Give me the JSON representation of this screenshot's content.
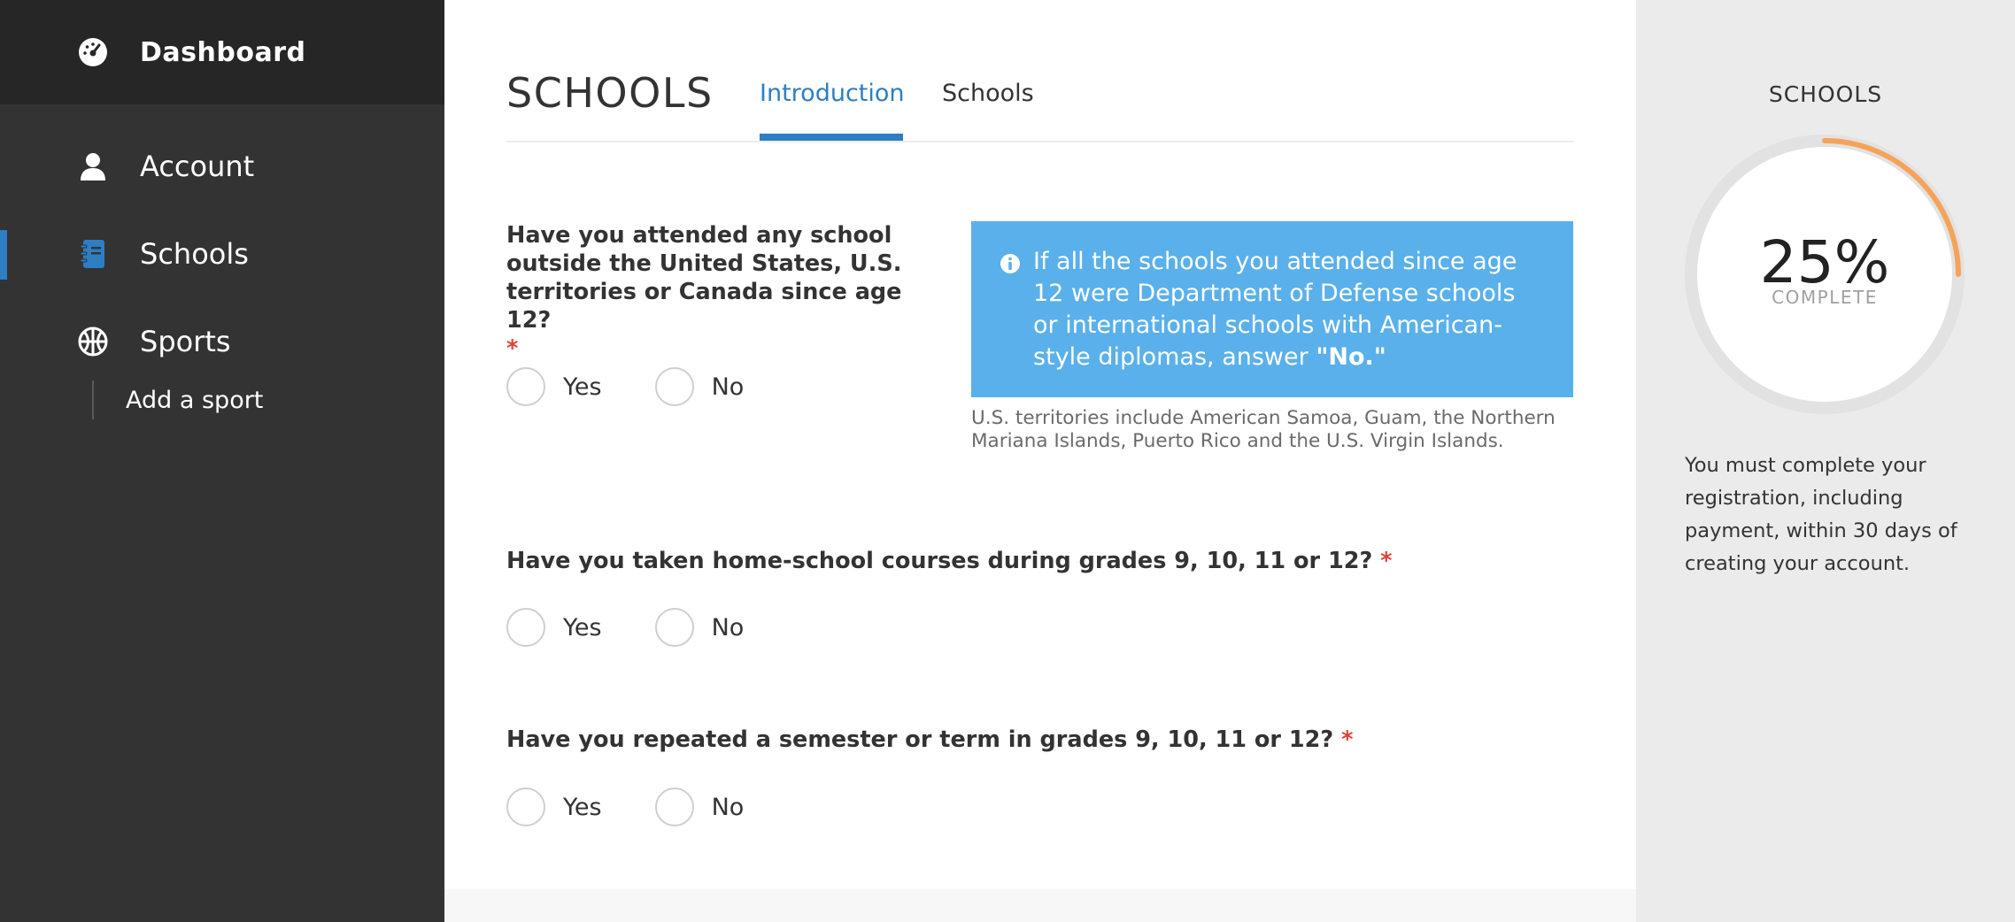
{
  "sidebar": {
    "header": {
      "label": "Dashboard",
      "icon": "dashboard-gauge-icon"
    },
    "items": [
      {
        "label": "Account",
        "icon": "user-icon"
      },
      {
        "label": "Schools",
        "icon": "notebook-icon"
      },
      {
        "label": "Sports",
        "icon": "ball-icon"
      }
    ],
    "sub_items": [
      {
        "label": "Add a sport"
      }
    ],
    "active_item": "Schools"
  },
  "main": {
    "title": "SCHOOLS",
    "tabs": [
      {
        "label": "Introduction",
        "active": true
      },
      {
        "label": "Schools",
        "active": false
      }
    ],
    "questions": [
      {
        "text": "Have you attended any school outside the United States, U.S. territories or Canada since age 12?",
        "required_mark": "*",
        "options": [
          "Yes",
          "No"
        ]
      },
      {
        "text": "Have you taken home-school courses during grades 9, 10, 11 or 12?",
        "required_mark": "*",
        "options": [
          "Yes",
          "No"
        ]
      },
      {
        "text": "Have you repeated a semester or term in grades 9, 10, 11 or 12?",
        "required_mark": "*",
        "options": [
          "Yes",
          "No"
        ]
      }
    ],
    "info": {
      "text": "If all the schools you attended since age 12 were Department of Defense schools or international schools with American-style diplomas, answer",
      "emphasis": "\"No.\"",
      "note": "U.S. territories include American Samoa, Guam, the Northern Mariana Islands, Puerto Rico and the U.S. Virgin Islands."
    }
  },
  "progress_panel": {
    "title": "SCHOOLS",
    "percent_label": "25%",
    "percent_fraction": 0.25,
    "status": "COMPLETE",
    "note": "You must complete your registration, including payment, within 30 days of creating your account."
  },
  "colors": {
    "sidebar_bg": "#333333",
    "sidebar_header_bg": "#262626",
    "accent": "#2d7ec3",
    "info_bg": "#5ab0ea",
    "progress": "#f5a35a",
    "required": "#e0403a"
  }
}
